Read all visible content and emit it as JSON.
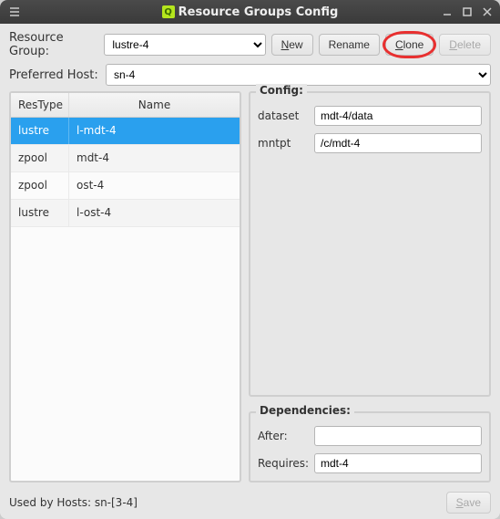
{
  "titlebar": {
    "title": "Resource Groups Config"
  },
  "row1": {
    "label": "Resource Group:",
    "selected": "lustre-4",
    "new_btn": "New",
    "rename_btn": "Rename",
    "clone_btn": "Clone",
    "delete_btn": "Delete"
  },
  "row2": {
    "label": "Preferred Host:",
    "selected": "sn-4"
  },
  "table": {
    "col_type": "ResType",
    "col_name": "Name",
    "rows": [
      {
        "type": "lustre",
        "name": "l-mdt-4",
        "selected": true
      },
      {
        "type": "zpool",
        "name": "mdt-4"
      },
      {
        "type": "zpool",
        "name": "ost-4"
      },
      {
        "type": "lustre",
        "name": "l-ost-4"
      }
    ]
  },
  "config": {
    "title": "Config:",
    "dataset_label": "dataset",
    "dataset_value": "mdt-4/data",
    "mntpt_label": "mntpt",
    "mntpt_value": "/c/mdt-4"
  },
  "deps": {
    "title": "Dependencies:",
    "after_label": "After:",
    "after_value": "",
    "requires_label": "Requires:",
    "requires_value": "mdt-4"
  },
  "footer": {
    "used_by": "Used by Hosts: sn-[3-4]",
    "save_btn": "Save"
  }
}
